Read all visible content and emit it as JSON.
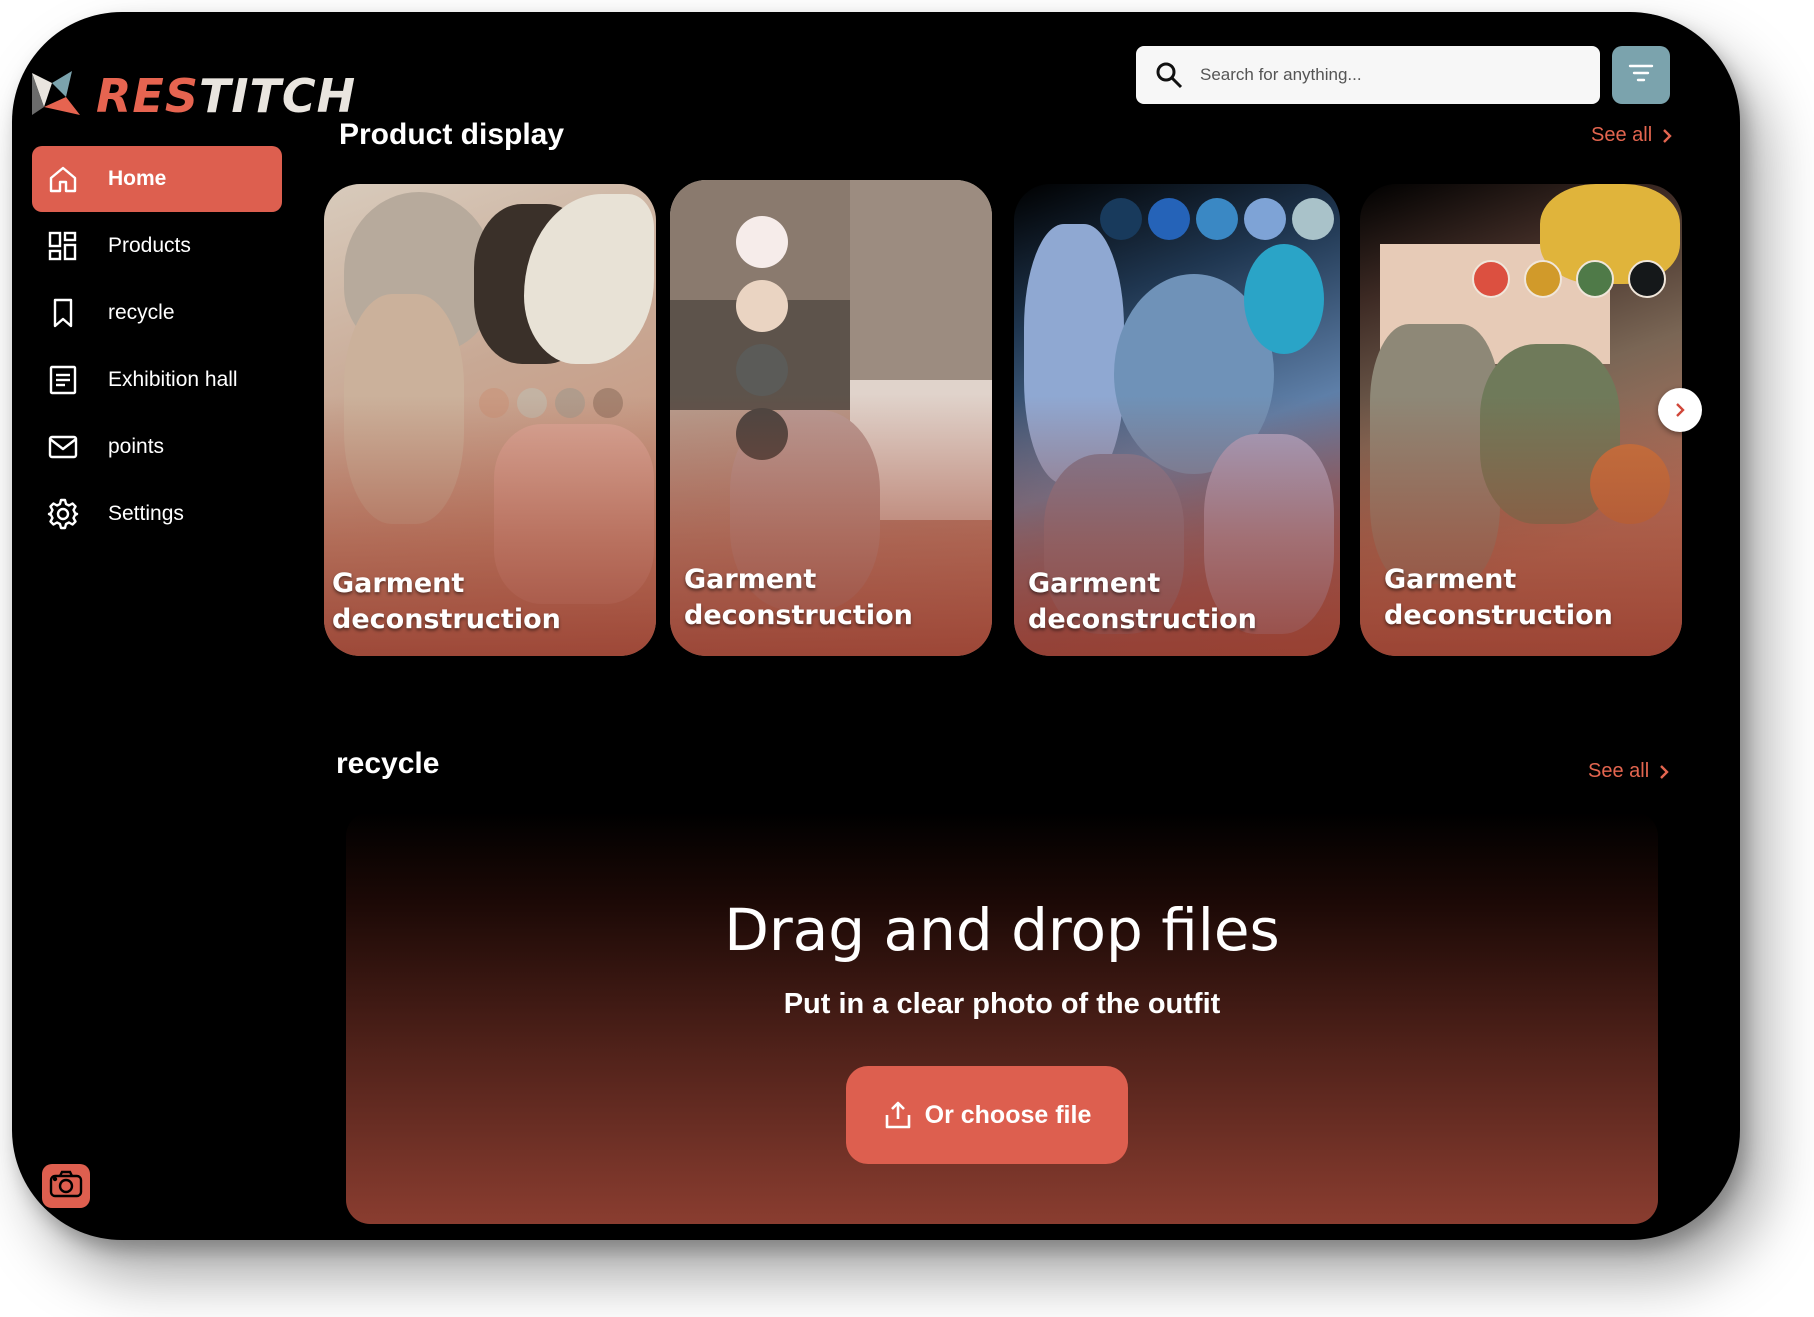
{
  "app": {
    "logo_text_a": "RES",
    "logo_text_b": "TITCH",
    "accent_color": "#dd5f4f",
    "filter_color": "#7ba3ad"
  },
  "search": {
    "placeholder": "Search for anything..."
  },
  "sidebar": {
    "items": [
      {
        "label": "Home",
        "icon": "home-icon",
        "active": true
      },
      {
        "label": "Products",
        "icon": "grid-icon",
        "active": false
      },
      {
        "label": "recycle",
        "icon": "bookmark-icon",
        "active": false
      },
      {
        "label": "Exhibition hall",
        "icon": "document-icon",
        "active": false
      },
      {
        "label": "points",
        "icon": "mail-icon",
        "active": false
      },
      {
        "label": "Settings",
        "icon": "gear-icon",
        "active": false
      }
    ]
  },
  "product_display": {
    "title": "Product display",
    "see_all": "See all",
    "cards": [
      {
        "title": "Garment deconstruction"
      },
      {
        "title": "Garment deconstruction"
      },
      {
        "title": "Garment deconstruction"
      },
      {
        "title": "Garment deconstruction"
      }
    ]
  },
  "recycle": {
    "title": "recycle",
    "see_all": "See all",
    "upload_title": "Drag and drop files",
    "upload_subtitle": "Put in a clear photo of the outfit",
    "choose_label": "Or choose file"
  }
}
